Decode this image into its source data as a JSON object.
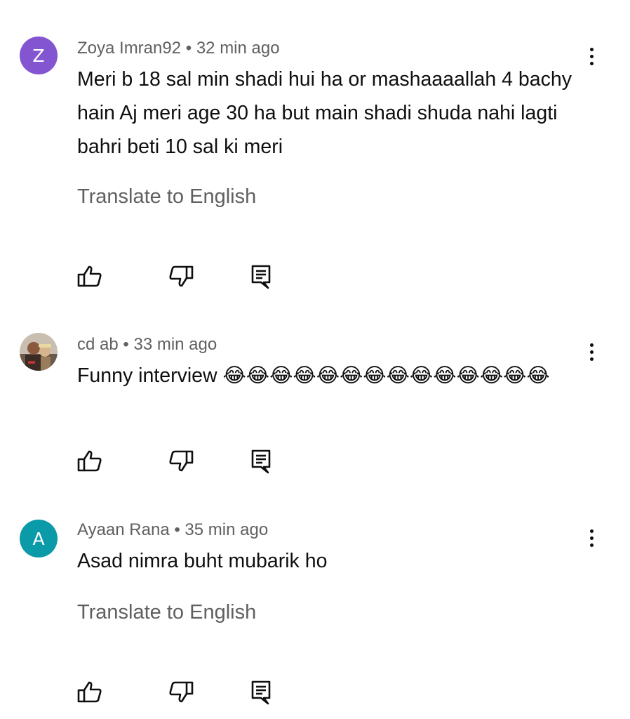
{
  "comments": [
    {
      "avatar_letter": "Z",
      "avatar_color": "#8455d1",
      "author": "Zoya Imran92",
      "separator": " • ",
      "time": "32 min ago",
      "text": "Meri b 18 sal min shadi hui ha or mashaaaallah 4 bachy hain Aj meri age 30 ha but main shadi shuda nahi lagti bahri beti 10 sal ki meri",
      "translate": "Translate to English"
    },
    {
      "avatar_photo": true,
      "author": "cd ab",
      "separator": " • ",
      "time": "33 min ago",
      "text": "Funny interview 😂😂😂😂😂😂😂😂😂😂😂😂😂😂"
    },
    {
      "avatar_letter": "A",
      "avatar_color": "#0b9aa8",
      "author": "Ayaan Rana",
      "separator": " • ",
      "time": "35 min ago",
      "text": "Asad nimra buht mubarik ho",
      "translate": "Translate to English"
    }
  ],
  "icons": {
    "like": "thumbs-up-icon",
    "dislike": "thumbs-down-icon",
    "reply": "reply-icon",
    "menu": "more-vert-icon"
  }
}
